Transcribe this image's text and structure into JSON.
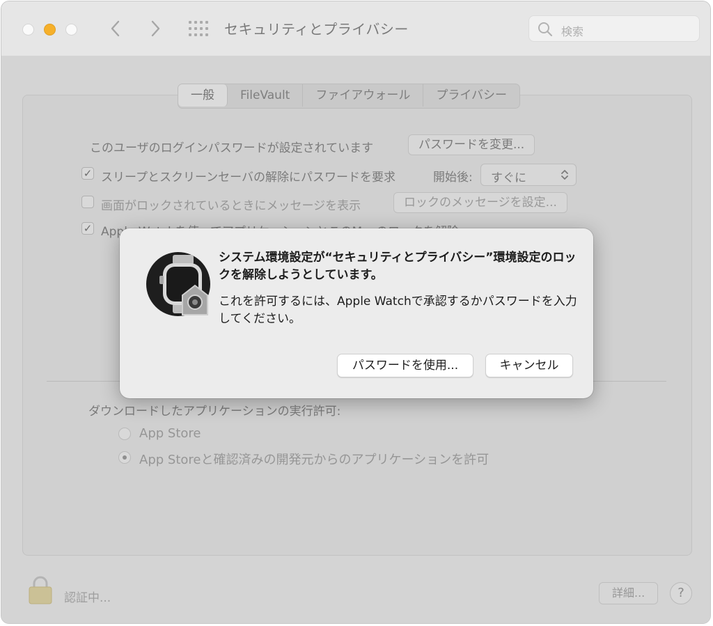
{
  "window": {
    "title": "セキュリティとプライバシー"
  },
  "search": {
    "placeholder": "検索"
  },
  "tabs": [
    {
      "label": "一般",
      "active": true
    },
    {
      "label": "FileVault",
      "active": false
    },
    {
      "label": "ファイアウォール",
      "active": false
    },
    {
      "label": "プライバシー",
      "active": false
    }
  ],
  "general": {
    "password_set_text": "このユーザのログインパスワードが設定されています",
    "change_password_button": "パスワードを変更...",
    "require_password": {
      "checked": true,
      "label": "スリープとスクリーンセーバの解除にパスワードを要求",
      "delay_label": "開始後:",
      "delay_value": "すぐに"
    },
    "show_message": {
      "checked": false,
      "label": "画面がロックされているときにメッセージを表示",
      "button": "ロックのメッセージを設定..."
    },
    "apple_watch": {
      "checked": true,
      "label": "Apple Watchを使ってアプリケーションとこのMacのロックを解除"
    },
    "downloads_label": "ダウンロードしたアプリケーションの実行許可:",
    "radio_options": [
      {
        "label": "App Store",
        "selected": false
      },
      {
        "label": "App Storeと確認済みの開発元からのアプリケーションを許可",
        "selected": true
      }
    ]
  },
  "footer": {
    "status": "認証中...",
    "advanced_button": "詳細...",
    "help": "?"
  },
  "dialog": {
    "title": "システム環境設定が“セキュリティとプライバシー”環境設定のロックを解除しようとしています。",
    "body": "これを許可するには、Apple Watchで承認するかパスワードを入力してください。",
    "use_password_button": "パスワードを使用...",
    "cancel_button": "キャンセル"
  },
  "colors": {
    "minimize_light": "#f6b02a",
    "dialog_bg": "#ececec"
  }
}
